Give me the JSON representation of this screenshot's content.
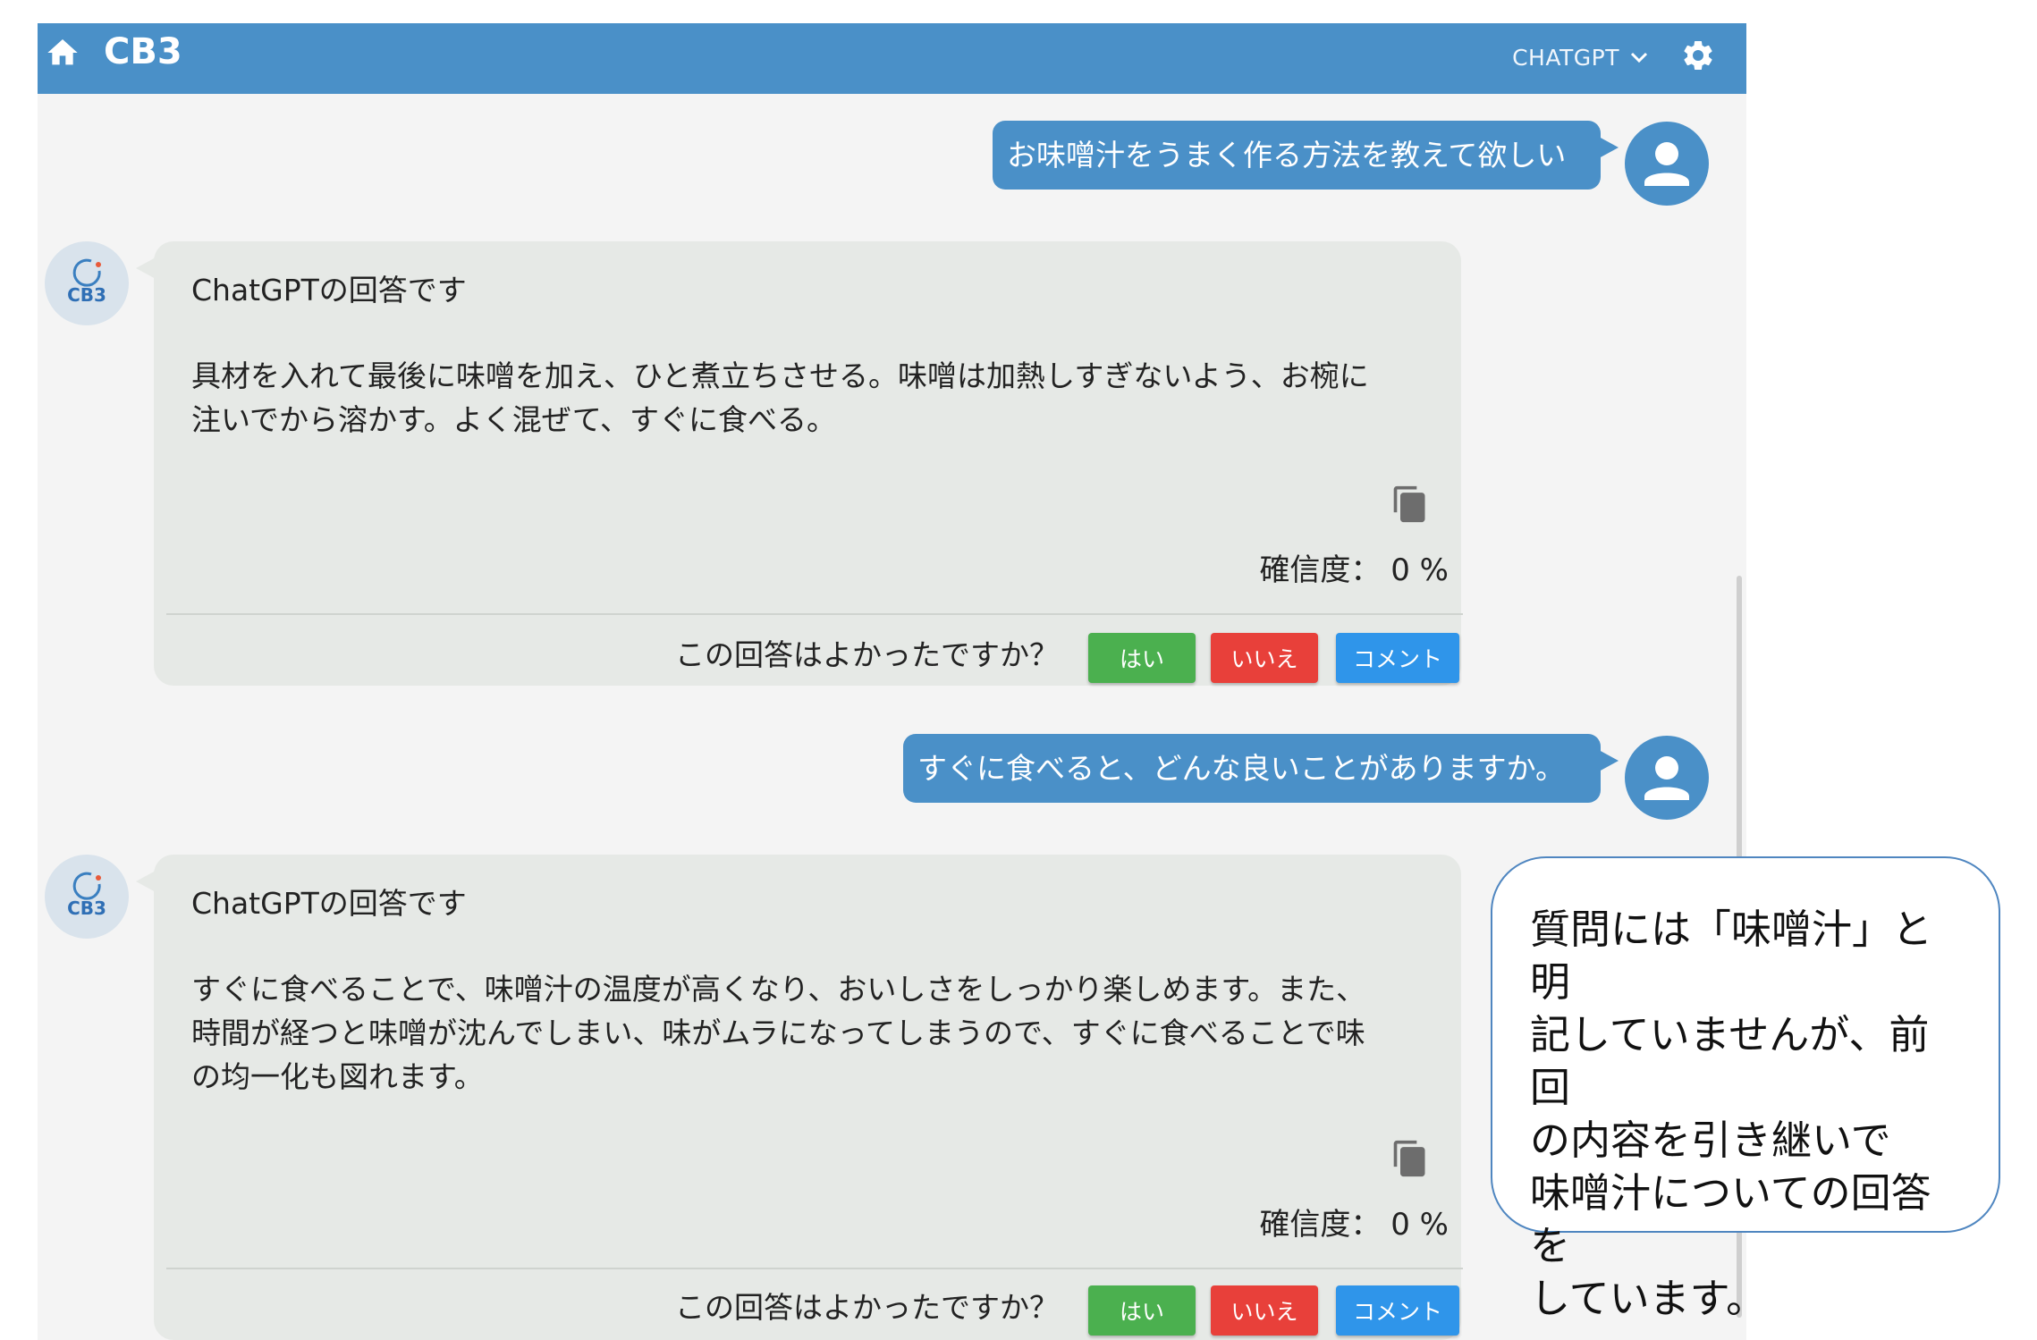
{
  "header": {
    "title": "CB3",
    "model_label": "CHATGPT"
  },
  "bot": {
    "logo_text": "CB3"
  },
  "messages": [
    {
      "role": "user",
      "text": "お味噌汁をうまく作る方法を教えて欲しい"
    },
    {
      "role": "bot",
      "heading": "ChatGPTの回答です",
      "lines": [
        "具材を入れて最後に味噌を加え、ひと煮立ちさせる。味噌は加熱しすぎないよう、お椀に",
        "注いでから溶かす。よく混ぜて、すぐに食べる。"
      ],
      "confidence": "確信度： 0 %",
      "feedback_question": "この回答はよかったですか？",
      "yes_label": "はい",
      "no_label": "いいえ",
      "comment_label": "コメント"
    },
    {
      "role": "user",
      "text": "すぐに食べると、どんな良いことがありますか。"
    },
    {
      "role": "bot",
      "heading": "ChatGPTの回答です",
      "lines": [
        "すぐに食べることで、味噌汁の温度が高くなり、おいしさをしっかり楽しめます。また、",
        "時間が経つと味噌が沈んでしまい、味がムラになってしまうので、すぐに食べることで味",
        "の均一化も図れます。"
      ],
      "confidence": "確信度： 0 %",
      "feedback_question": "この回答はよかったですか？",
      "yes_label": "はい",
      "no_label": "いいえ",
      "comment_label": "コメント"
    }
  ],
  "callout": {
    "lines": [
      "質問には「味噌汁」と明",
      "記していませんが、前回",
      "の内容を引き継いで",
      "味噌汁についての回答を",
      "しています。"
    ]
  },
  "colors": {
    "header": "#4a90c8",
    "user_bubble": "#4a90c8",
    "bot_card": "#e6e9e6",
    "yes_button": "#4bb04f",
    "no_button": "#e8403a",
    "comment_button": "#2f95ea",
    "callout_border": "#4f86c0"
  },
  "icons": [
    "home-icon",
    "chevron-down-icon",
    "gear-icon",
    "user-avatar-icon",
    "cb3-logo-icon",
    "copy-icon"
  ]
}
